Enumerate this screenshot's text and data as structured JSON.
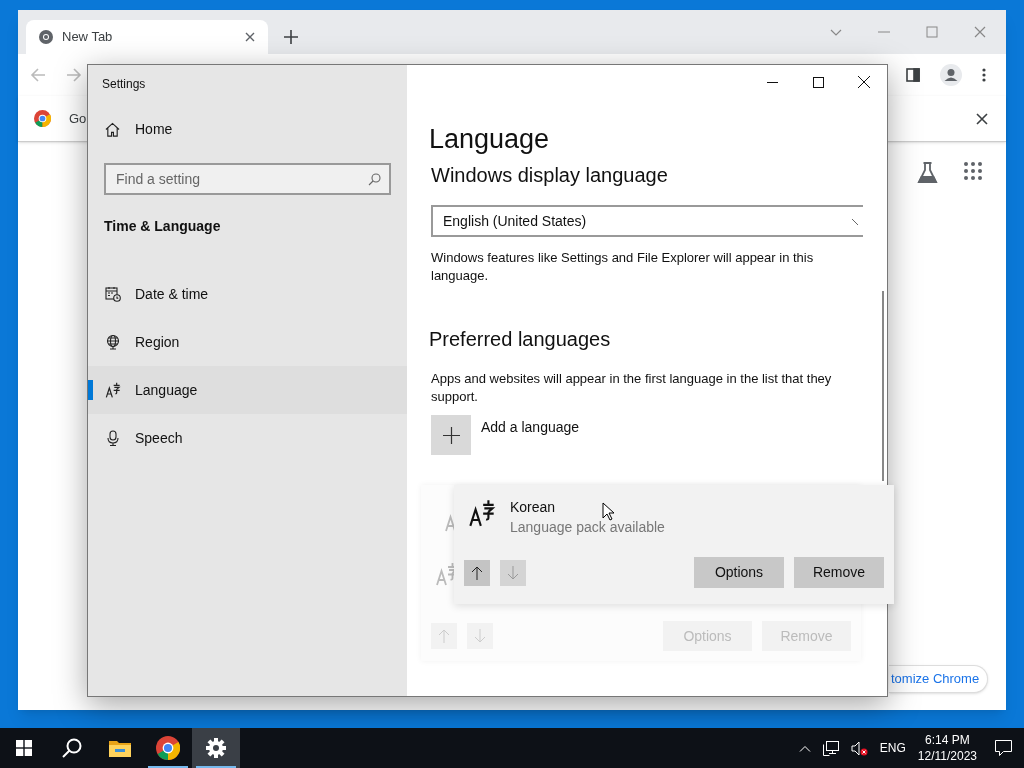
{
  "browser": {
    "tabs": [
      {
        "title": "New Tab",
        "selected": true
      }
    ],
    "bookmarks": [
      {
        "label": "Go"
      }
    ],
    "customize_button": "tomize Chrome"
  },
  "settings": {
    "title": "Settings",
    "home": "Home",
    "search": {
      "placeholder": "Find a setting"
    },
    "section": "Time & Language",
    "nav": [
      {
        "kind": "calendar",
        "label": "Date & time",
        "selected": false
      },
      {
        "kind": "globe",
        "label": "Region",
        "selected": false
      },
      {
        "kind": "language",
        "label": "Language",
        "selected": true
      },
      {
        "kind": "microphone",
        "label": "Speech",
        "selected": false
      }
    ],
    "page_title": "Language",
    "display_heading": "Windows display language",
    "display_select": "English (United States)",
    "display_note": "Windows features like Settings and File Explorer will appear in this language.",
    "preferred_heading": "Preferred languages",
    "preferred_note": "Apps and websites will appear in the first language in the list that they support.",
    "add_language": "Add a language",
    "dragged_language": {
      "name": "Korean",
      "status": "Language pack available",
      "arrows": [
        {
          "kind": "up",
          "disabled": false
        },
        {
          "kind": "down",
          "disabled": true
        }
      ],
      "buttons": [
        "Options",
        "Remove"
      ]
    },
    "placeholder_buttons": [
      "Options",
      "Remove"
    ]
  },
  "taskbar": {
    "apps": [
      {
        "kind": "start",
        "open": false,
        "selected": false
      },
      {
        "kind": "search",
        "open": false,
        "selected": false
      },
      {
        "kind": "folder",
        "open": false,
        "selected": false
      },
      {
        "kind": "chrome",
        "open": true,
        "selected": false
      },
      {
        "kind": "settings",
        "open": true,
        "selected": true
      }
    ],
    "language": "ENG",
    "time": "6:14 PM",
    "date": "12/11/2023"
  }
}
